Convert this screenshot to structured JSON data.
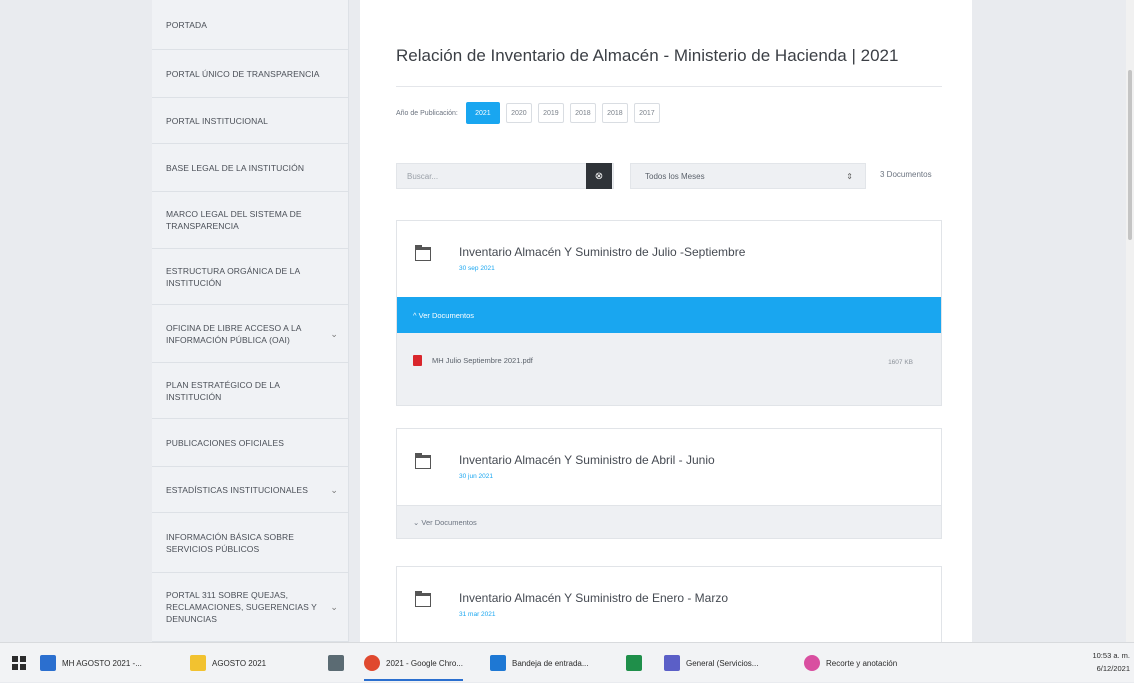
{
  "sidebar": {
    "items": [
      {
        "label": "PORTADA"
      },
      {
        "label": "PORTAL ÚNICO DE TRANSPARENCIA"
      },
      {
        "label": "PORTAL INSTITUCIONAL"
      },
      {
        "label": "BASE LEGAL DE LA INSTITUCIÓN"
      },
      {
        "label": "MARCO LEGAL DEL SISTEMA DE TRANSPARENCIA"
      },
      {
        "label": "ESTRUCTURA ORGÁNICA DE LA INSTITUCIÓN"
      },
      {
        "label": "OFICINA DE LIBRE ACCESO A LA INFORMACIÓN PÚBLICA (OAI)",
        "chevron": "⌄"
      },
      {
        "label": "PLAN ESTRATÉGICO DE LA INSTITUCIÓN"
      },
      {
        "label": "PUBLICACIONES OFICIALES"
      },
      {
        "label": "ESTADÍSTICAS INSTITUCIONALES",
        "chevron": "⌄"
      },
      {
        "label": "INFORMACIÓN BÁSICA SOBRE SERVICIOS PÚBLICOS"
      },
      {
        "label": "PORTAL 311 SOBRE QUEJAS, RECLAMACIONES, SUGERENCIAS Y DENUNCIAS",
        "chevron": "⌄"
      }
    ]
  },
  "main": {
    "title": "Relación de Inventario de Almacén - Ministerio de Hacienda | 2021",
    "year_label": "Año de Publicación:",
    "years": [
      "2021",
      "2020",
      "2019",
      "2018",
      "2018",
      "2017"
    ],
    "search_placeholder": "Buscar...",
    "search_icon": "⊗",
    "month_select": "Todos los Meses",
    "select_arrows": "⇕",
    "doc_count": "3 Documentos"
  },
  "cards": [
    {
      "title": "Inventario Almacén Y Suministro de Julio -Septiembre",
      "date": "30 sep 2021",
      "toggle_label": "^ Ver Documentos",
      "expanded": true,
      "doc_name": "MH Julio Septiembre 2021.pdf",
      "doc_size": "1607 KB"
    },
    {
      "title": "Inventario Almacén Y Suministro de Abril - Junio",
      "date": "30 jun 2021",
      "toggle_label": "⌄ Ver Documentos",
      "expanded": false
    },
    {
      "title": "Inventario Almacén Y Suministro de Enero - Marzo",
      "date": "31 mar 2021"
    }
  ],
  "taskbar": {
    "items": [
      {
        "label": "MH AGOSTO 2021 -...",
        "color": "#2b6fcf"
      },
      {
        "label": "AGOSTO 2021",
        "color": "#f2c230"
      },
      {
        "label": "",
        "color": "#5b6b73"
      },
      {
        "label": "2021 - Google Chro...",
        "color": "#e0492f"
      },
      {
        "label": "Bandeja de entrada...",
        "color": "#1e78d4"
      },
      {
        "label": "",
        "color": "#1f8f4a"
      },
      {
        "label": "General (Servicios...",
        "color": "#5b5fc7"
      },
      {
        "label": "Recorte y anotación",
        "color": "#d94fa0"
      }
    ],
    "time": "10:53 a. m.",
    "date": "6/12/2021"
  },
  "colors": {
    "accent": "#19a6f0",
    "pdf": "#d9262c"
  }
}
